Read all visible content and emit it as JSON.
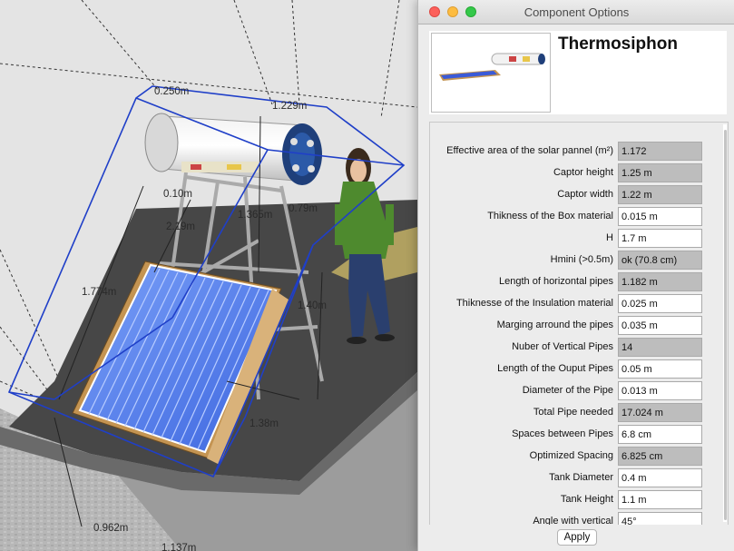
{
  "window": {
    "title": "Component Options",
    "component_name": "Thermosiphon",
    "apply_label": "Apply"
  },
  "fields": [
    {
      "label": "Effective area of the solar pannel (m²)",
      "value": "1.172",
      "editable": false
    },
    {
      "label": "Captor height",
      "value": "1.25 m",
      "editable": false
    },
    {
      "label": "Captor width",
      "value": "1.22 m",
      "editable": false
    },
    {
      "label": "Thikness of the Box material",
      "value": "0.015 m",
      "editable": true
    },
    {
      "label": "H",
      "value": "1.7 m",
      "editable": true
    },
    {
      "label": "Hmini (>0.5m)",
      "value": "ok (70.8 cm)",
      "editable": false
    },
    {
      "label": "Length of horizontal pipes",
      "value": "1.182 m",
      "editable": false
    },
    {
      "label": "Thiknesse of the Insulation material",
      "value": "0.025 m",
      "editable": true
    },
    {
      "label": "Marging arround the pipes",
      "value": "0.035 m",
      "editable": true
    },
    {
      "label": "Nuber of Vertical Pipes",
      "value": "14",
      "editable": false
    },
    {
      "label": "Length of the Ouput Pipes",
      "value": "0.05 m",
      "editable": true
    },
    {
      "label": "Diameter of the Pipe",
      "value": "0.013 m",
      "editable": true
    },
    {
      "label": "Total Pipe needed",
      "value": "17.024 m",
      "editable": false
    },
    {
      "label": "Spaces between Pipes",
      "value": "6.8 cm",
      "editable": true
    },
    {
      "label": "Optimized Spacing",
      "value": "6.825 cm",
      "editable": false
    },
    {
      "label": "Tank Diameter",
      "value": "0.4 m",
      "editable": true
    },
    {
      "label": "Tank Height",
      "value": "1.1 m",
      "editable": true
    },
    {
      "label": "Angle with vertical",
      "value": "45°",
      "editable": true
    }
  ],
  "dimension_labels": {
    "d1": "0.250m",
    "d2": "1.229m",
    "d3": "0.10m",
    "d4": "2.19m",
    "d5": "1.365m",
    "d6": "0.79m",
    "d7": "1.774m",
    "d8": "1.40m",
    "d9": "1.38m",
    "d10": "0.962m",
    "d11": "1.137m"
  },
  "colors": {
    "selection_box": "#1f3fc8",
    "panel_blue": "#4a73e8",
    "roof": "#474747",
    "wall": "#b9b9b9"
  }
}
